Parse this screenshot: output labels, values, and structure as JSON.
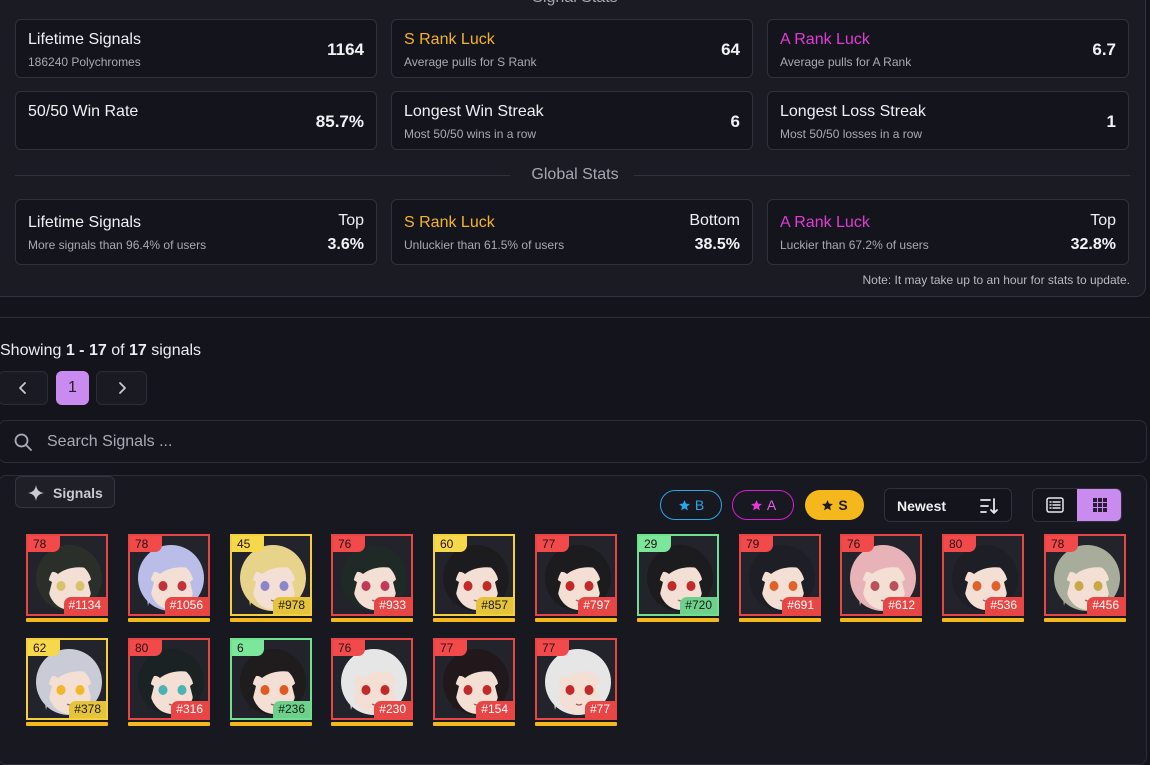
{
  "signal_stats": {
    "heading": "Signal Stats",
    "cards": [
      {
        "title": "Lifetime Signals",
        "sub": "186240 Polychromes",
        "value": "1164",
        "color": ""
      },
      {
        "title": "S Rank Luck",
        "sub": "Average pulls for S Rank",
        "value": "64",
        "color": "s"
      },
      {
        "title": "A Rank Luck",
        "sub": "Average pulls for A Rank",
        "value": "6.7",
        "color": "a"
      },
      {
        "title": "50/50 Win Rate",
        "sub": "",
        "value": "85.7%",
        "color": ""
      },
      {
        "title": "Longest Win Streak",
        "sub": "Most 50/50 wins in a row",
        "value": "6",
        "color": ""
      },
      {
        "title": "Longest Loss Streak",
        "sub": "Most 50/50 losses in a row",
        "value": "1",
        "color": ""
      }
    ]
  },
  "global_stats": {
    "heading": "Global Stats",
    "cards": [
      {
        "title": "Lifetime Signals",
        "sub": "More signals than 96.4% of users",
        "label": "Top",
        "value": "3.6%",
        "color": ""
      },
      {
        "title": "S Rank Luck",
        "sub": "Unluckier than 61.5% of users",
        "label": "Bottom",
        "value": "38.5%",
        "color": "s"
      },
      {
        "title": "A Rank Luck",
        "sub": "Luckier than 67.2% of users",
        "label": "Top",
        "value": "32.8%",
        "color": "a"
      }
    ],
    "note": "Note: It may take up to an hour for stats to update."
  },
  "list_header": {
    "showing_prefix": "Showing",
    "range": "1 - 17",
    "of": "of",
    "total": "17",
    "suffix": "signals"
  },
  "pagination": {
    "current": "1"
  },
  "search": {
    "placeholder": "Search Signals ..."
  },
  "signals_tag": "Signals",
  "filters": [
    {
      "label": "B",
      "class": "b"
    },
    {
      "label": "A",
      "class": "a"
    },
    {
      "label": "S",
      "class": "s"
    }
  ],
  "sort": {
    "label": "Newest"
  },
  "colors": {
    "s_rank": "#f5b32a",
    "a_rank": "#e23ad6",
    "b_rank": "#2aa6e6",
    "accent": "#c98bf0",
    "bar": "#f5b81c"
  },
  "signals": [
    {
      "pity": "78",
      "number": "#1134",
      "rank": "s",
      "hair": "#2a2f2a",
      "eye": "#d9c36a"
    },
    {
      "pity": "78",
      "number": "#1056",
      "rank": "s",
      "hair": "#b9bde8",
      "eye": "#c2323b"
    },
    {
      "pity": "45",
      "number": "#978",
      "rank": "a",
      "hair": "#e7d48a",
      "eye": "#8a86c9"
    },
    {
      "pity": "76",
      "number": "#933",
      "rank": "s",
      "hair": "#1f2a27",
      "eye": "#c23a5a"
    },
    {
      "pity": "60",
      "number": "#857",
      "rank": "a",
      "hair": "#1c1c1f",
      "eye": "#c22a2a"
    },
    {
      "pity": "77",
      "number": "#797",
      "rank": "s",
      "hair": "#1c1c1f",
      "eye": "#c22a2a"
    },
    {
      "pity": "29",
      "number": "#720",
      "rank": "b",
      "hair": "#1c1c1f",
      "eye": "#c22a2a"
    },
    {
      "pity": "79",
      "number": "#691",
      "rank": "s",
      "hair": "#1e1e26",
      "eye": "#e0622a"
    },
    {
      "pity": "76",
      "number": "#612",
      "rank": "s",
      "hair": "#e8b3b8",
      "eye": "#b9505a"
    },
    {
      "pity": "80",
      "number": "#536",
      "rank": "s",
      "hair": "#1e1e26",
      "eye": "#e0622a"
    },
    {
      "pity": "78",
      "number": "#456",
      "rank": "s",
      "hair": "#a7ad9a",
      "eye": "#c9a84a"
    },
    {
      "pity": "62",
      "number": "#378",
      "rank": "a",
      "hair": "#c9ccd6",
      "eye": "#f2b62a"
    },
    {
      "pity": "80",
      "number": "#316",
      "rank": "s",
      "hair": "#1b2224",
      "eye": "#4ab3b3"
    },
    {
      "pity": "6",
      "number": "#236",
      "rank": "b",
      "hair": "#1e1c1c",
      "eye": "#e05a22"
    },
    {
      "pity": "76",
      "number": "#230",
      "rank": "s",
      "hair": "#e6e6e6",
      "eye": "#c22a2a"
    },
    {
      "pity": "77",
      "number": "#154",
      "rank": "s",
      "hair": "#20181a",
      "eye": "#c22a2a"
    },
    {
      "pity": "77",
      "number": "#77",
      "rank": "s",
      "hair": "#e6e6e6",
      "eye": "#c22a2a"
    }
  ]
}
